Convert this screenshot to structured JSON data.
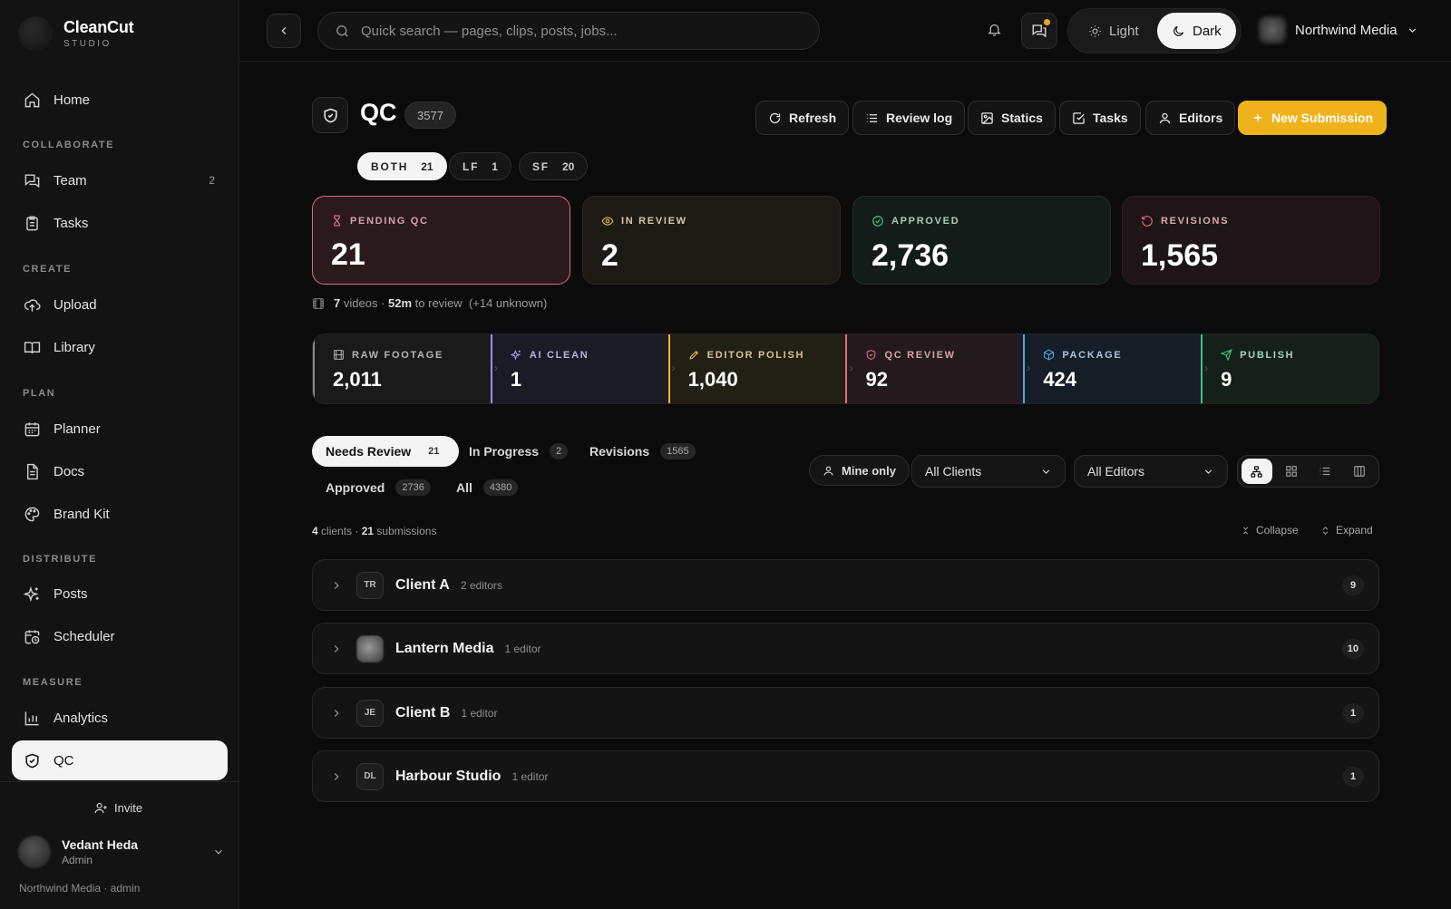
{
  "brand": {
    "name": "CleanCut",
    "sub": "STUDIO"
  },
  "sidebar": {
    "home": "Home",
    "sections": {
      "collaborate": "COLLABORATE",
      "create": "CREATE",
      "plan": "PLAN",
      "distribute": "DISTRIBUTE",
      "measure": "MEASURE"
    },
    "items": {
      "team": {
        "label": "Team",
        "count": "2"
      },
      "tasks": "Tasks",
      "upload": "Upload",
      "library": "Library",
      "planner": "Planner",
      "docs": "Docs",
      "brandkit": "Brand Kit",
      "posts": "Posts",
      "scheduler": "Scheduler",
      "analytics": "Analytics",
      "qc": "QC"
    },
    "invite": "Invite",
    "user": {
      "name": "Vedant Heda",
      "role": "Admin"
    },
    "org_line": "Northwind Media · admin"
  },
  "topbar": {
    "search_placeholder": "Quick search — pages, clips, posts, jobs...",
    "theme_light": "Light",
    "theme_dark": "Dark",
    "org_name": "Northwind Media"
  },
  "header": {
    "title": "QC",
    "total": "3577",
    "buttons": {
      "refresh": "Refresh",
      "review_log": "Review log",
      "statics": "Statics",
      "tasks": "Tasks",
      "editors": "Editors",
      "new_submission": "New Submission"
    }
  },
  "formats": [
    {
      "label": "BOTH",
      "count": "21"
    },
    {
      "label": "LF",
      "count": "1"
    },
    {
      "label": "SF",
      "count": "20"
    }
  ],
  "status_cards": {
    "pending": {
      "label": "PENDING QC",
      "value": "21"
    },
    "in_review": {
      "label": "IN REVIEW",
      "value": "2"
    },
    "approved": {
      "label": "APPROVED",
      "value": "2,736"
    },
    "revisions": {
      "label": "REVISIONS",
      "value": "1,565"
    }
  },
  "summary": {
    "videos": "7",
    "videos_label": "videos ·",
    "time": "52m",
    "time_label": "to review",
    "unknown": "(+14 unknown)"
  },
  "pipeline": [
    {
      "label": "RAW FOOTAGE",
      "value": "2,011"
    },
    {
      "label": "AI CLEAN",
      "value": "1"
    },
    {
      "label": "EDITOR POLISH",
      "value": "1,040"
    },
    {
      "label": "QC REVIEW",
      "value": "92"
    },
    {
      "label": "PACKAGE",
      "value": "424"
    },
    {
      "label": "PUBLISH",
      "value": "9"
    }
  ],
  "tabs": [
    {
      "label": "Needs Review",
      "count": "21"
    },
    {
      "label": "In Progress",
      "count": "2"
    },
    {
      "label": "Revisions",
      "count": "1565"
    },
    {
      "label": "Approved",
      "count": "2736"
    },
    {
      "label": "All",
      "count": "4380"
    }
  ],
  "filters": {
    "mine_only": "Mine only",
    "clients": "All Clients",
    "editors": "All Editors"
  },
  "list_summary": {
    "clients": "4",
    "clients_label": "clients ·",
    "submissions": "21",
    "submissions_label": "submissions"
  },
  "list_actions": {
    "collapse": "Collapse",
    "expand": "Expand"
  },
  "clients": [
    {
      "initials": "TR",
      "name": "Client A",
      "editors": "2 editors",
      "count": "9"
    },
    {
      "initials": "",
      "name": "Lantern Media",
      "editors": "1 editor",
      "count": "10"
    },
    {
      "initials": "JE",
      "name": "Client B",
      "editors": "1 editor",
      "count": "1"
    },
    {
      "initials": "DL",
      "name": "Harbour Studio",
      "editors": "1 editor",
      "count": "1"
    }
  ],
  "colors": {
    "accent": "#f0b21a",
    "pending_border": "#d96a80",
    "bg": "#0b0b0c"
  }
}
